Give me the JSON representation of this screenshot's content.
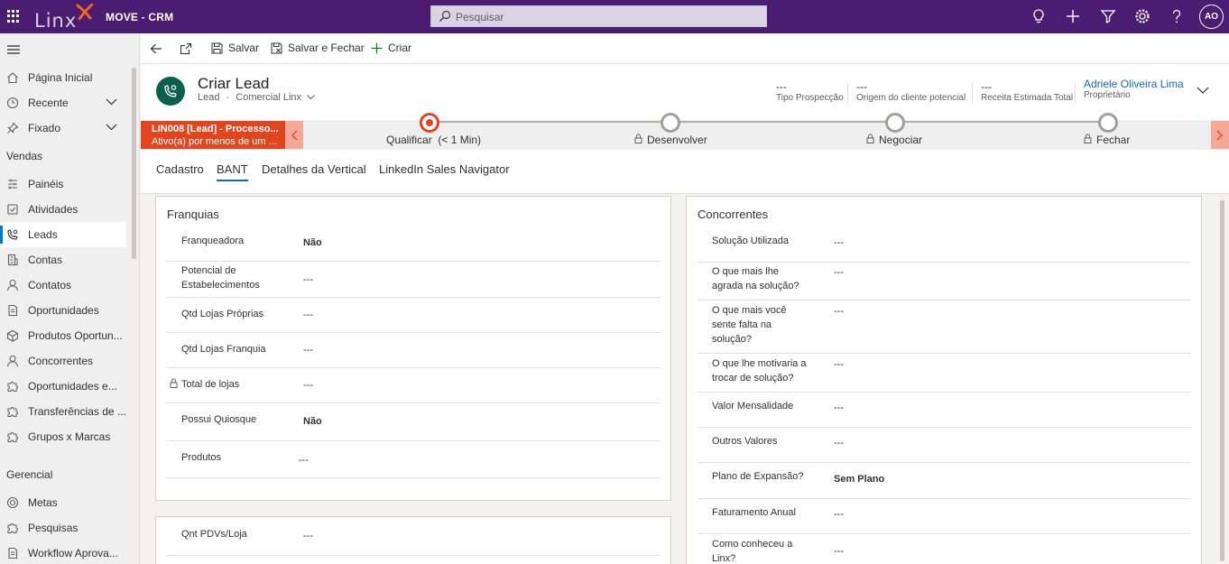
{
  "topbar": {
    "app_name": "MOVE - CRM",
    "logo_text": "Linx",
    "search_placeholder": "Pesquisar",
    "avatar_initials": "AO"
  },
  "sidebar": {
    "top_items": [
      {
        "label": "Página Inicial",
        "icon": "home-icon"
      },
      {
        "label": "Recente",
        "icon": "clock-icon"
      },
      {
        "label": "Fixado",
        "icon": "pin-icon"
      }
    ],
    "group_vendas": "Vendas",
    "vendas_items": [
      {
        "label": "Painéis",
        "icon": "dashboard-icon"
      },
      {
        "label": "Atividades",
        "icon": "activities-icon"
      },
      {
        "label": "Leads",
        "icon": "phone-person-icon",
        "active": true
      },
      {
        "label": "Contas",
        "icon": "building-icon"
      },
      {
        "label": "Contatos",
        "icon": "person-icon"
      },
      {
        "label": "Oportunidades",
        "icon": "document-icon"
      },
      {
        "label": "Produtos Oportun...",
        "icon": "cube-icon"
      },
      {
        "label": "Concorrentes",
        "icon": "person-icon"
      },
      {
        "label": "Oportunidades e...",
        "icon": "puzzle-icon"
      },
      {
        "label": "Transferências de ...",
        "icon": "puzzle-icon"
      },
      {
        "label": "Grupos x Marcas",
        "icon": "puzzle-icon"
      }
    ],
    "group_gerencial": "Gerencial",
    "gerencial_items": [
      {
        "label": "Metas",
        "icon": "target-icon"
      },
      {
        "label": "Pesquisas",
        "icon": "puzzle-icon"
      },
      {
        "label": "Workflow Aprova...",
        "icon": "document-icon"
      }
    ]
  },
  "cmdbar": {
    "save": "Salvar",
    "save_close": "Salvar e Fechar",
    "create": "Criar"
  },
  "header": {
    "title": "Criar Lead",
    "entity": "Lead",
    "form_name": "Comercial Linx",
    "fields": [
      {
        "value": "---",
        "label": "Tipo Prospecção"
      },
      {
        "value": "---",
        "label": "Origem do cliente potencial"
      },
      {
        "value": "---",
        "label": "Receita Estimada Total"
      },
      {
        "value": "Adriele Oliveira Lima",
        "label": "Proprietário"
      }
    ]
  },
  "bpf": {
    "process_title": "LIN008 [Lead] - Processo...",
    "process_sub": "Ativo(a) por menos de um ...",
    "stages": [
      {
        "label": "Qualificar",
        "duration": "(< 1 Min)",
        "active": true
      },
      {
        "label": "Desenvolver",
        "locked": true
      },
      {
        "label": "Negociar",
        "locked": true
      },
      {
        "label": "Fechar",
        "locked": true
      }
    ]
  },
  "tabs": [
    "Cadastro",
    "BANT",
    "Detalhes da Vertical",
    "LinkedIn Sales Navigator"
  ],
  "franquias": {
    "title": "Franquias",
    "rows": [
      {
        "label": "Franqueadora",
        "value": "Não",
        "bold": true
      },
      {
        "label": "Potencial de Estabelecimentos",
        "value": "---"
      },
      {
        "label": "Qtd Lojas Próprias",
        "value": "---"
      },
      {
        "label": "Qtd Lojas Franquia",
        "value": "---"
      },
      {
        "label": "Total de lojas",
        "value": "---",
        "locked": true
      },
      {
        "label": "Possui Quiosque",
        "value": "Não",
        "bold": true
      },
      {
        "label": "Produtos",
        "value": "---"
      }
    ]
  },
  "pdv": {
    "rows": [
      {
        "label": "Qnt PDVs/Loja",
        "value": "---"
      }
    ]
  },
  "concorrentes": {
    "title": "Concorrentes",
    "rows": [
      {
        "label": "Solução Utilizada",
        "value": "---"
      },
      {
        "label": "O que mais lhe agrada na solução?",
        "value": "---"
      },
      {
        "label": "O que mais você sente falta na solução?",
        "value": "---"
      },
      {
        "label": "O que lhe motivaria a trocar de solução?",
        "value": "---"
      },
      {
        "label": "Valor Mensalidade",
        "value": "---"
      },
      {
        "label": "Outros Valores",
        "value": "---"
      },
      {
        "label": "Plano de Expansão?",
        "value": "Sem Plano",
        "bold": true
      },
      {
        "label": "Faturamento Anual",
        "value": "---"
      },
      {
        "label": "Como conheceu a Linx?",
        "value": "---"
      }
    ]
  }
}
